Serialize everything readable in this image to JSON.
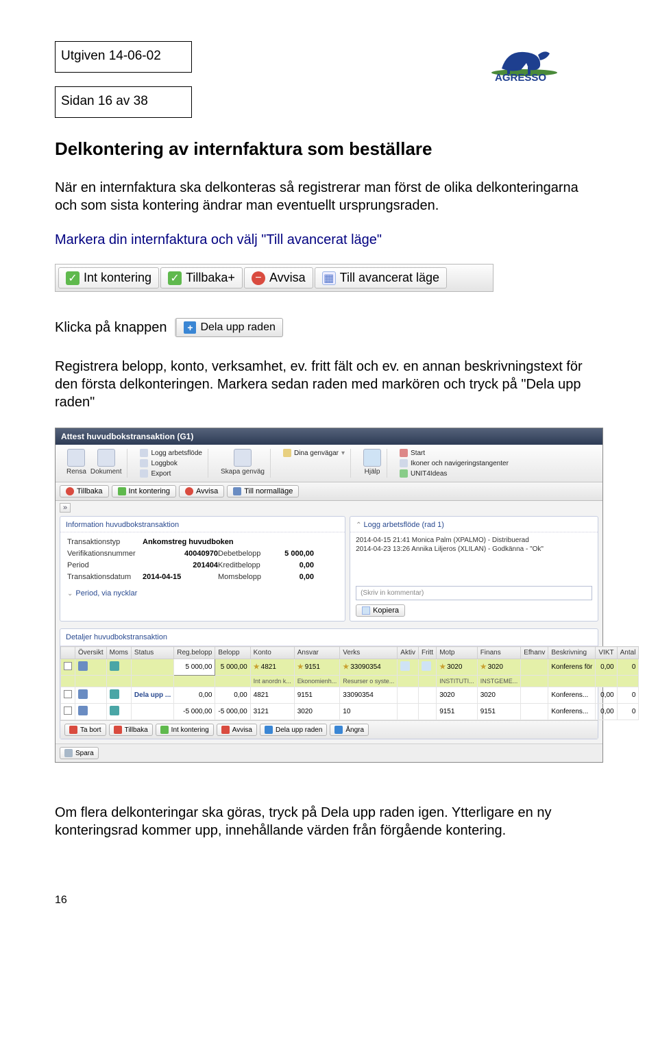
{
  "header": {
    "issued": "Utgiven 14-06-02",
    "page_info": "Sidan 16 av 38",
    "brand": "AGRESSO"
  },
  "title": "Delkontering av internfaktura som beställare",
  "para1": "När en internfaktura ska delkonteras så registrerar man först de olika delkonteringarna och som sista kontering ändrar man eventuellt ursprungsraden.",
  "marker_line": "Markera din internfaktura och välj \"Till avancerat läge\"",
  "toolbar1": {
    "int_kontering": "Int kontering",
    "tillbaka_plus": "Tillbaka+",
    "avvisa": "Avvisa",
    "till_avancerat": "Till avancerat läge"
  },
  "click_line": "Klicka på knappen",
  "split_btn": "Dela upp raden",
  "para2": "Registrera belopp, konto, verksamhet, ev. fritt fält och ev. en annan beskrivningstext för den första delkonteringen. Markera sedan raden med markören och tryck på \"Dela upp raden\"",
  "app": {
    "title": "Attest huvudbokstransaktion (G1)",
    "ribbon": {
      "rensa": "Rensa",
      "dokument": "Dokument",
      "logg_arbetsflode": "Logg arbetsflöde",
      "loggbok": "Loggbok",
      "export": "Export",
      "skapa_genvag": "Skapa genväg",
      "dina_genvagar": "Dina genvägar",
      "hjalp": "Hjälp",
      "start": "Start",
      "ikoner": "Ikoner och navigeringstangenter",
      "unit4": "UNIT4Ideas"
    },
    "toolbar2": {
      "tillbaka": "Tillbaka",
      "int_kontering": "Int kontering",
      "avvisa": "Avvisa",
      "normallage": "Till normalläge"
    },
    "info_pane": {
      "title": "Information huvudbokstransaktion",
      "labels": {
        "transaktionstyp": "Transaktionstyp",
        "verifikationsnummer": "Verifikationsnummer",
        "period": "Period",
        "transaktionsdatum": "Transaktionsdatum",
        "debetbelopp": "Debetbelopp",
        "kreditbelopp": "Kreditbelopp",
        "momsbelopp": "Momsbelopp"
      },
      "values": {
        "transaktionstyp": "Ankomstreg huvudboken",
        "verifikationsnummer": "40040970",
        "period": "201404",
        "transaktionsdatum": "2014-04-15",
        "debetbelopp": "5 000,00",
        "kreditbelopp": "0,00",
        "momsbelopp": "0,00"
      },
      "period_via": "Period, via nycklar"
    },
    "log_pane": {
      "title": "Logg arbetsflöde (rad 1)",
      "l1": "2014-04-15 21:41 Monica Palm (XPALMO) - Distribuerad",
      "l2": "2014-04-23 13:26 Annika Liljeros (XLILAN) - Godkänna - \"Ok\"",
      "comment_placeholder": "(Skriv in kommentar)",
      "kopiera": "Kopiera"
    },
    "detail": {
      "title": "Detaljer huvudbokstransaktion",
      "headers": [
        "",
        "Översikt",
        "Moms",
        "Status",
        "Reg.belopp",
        "Belopp",
        "Konto",
        "Ansvar",
        "Verks",
        "Aktiv",
        "Fritt",
        "Motp",
        "Finans",
        "Efhanv",
        "Beskrivning",
        "VIKT",
        "Antal"
      ],
      "row1": {
        "reg": "5 000,00",
        "belopp": "5 000,00",
        "konto": "4821",
        "ansvar": "9151",
        "verks": "33090354",
        "motp": "3020",
        "finans": "3020",
        "beskr": "Konferens för",
        "vikt": "0,00",
        "antal": "0"
      },
      "row1_sub": {
        "konto": "Int anordn k...",
        "ansvar": "Ekonomienh...",
        "verks": "Resurser o syste...",
        "motp": "INSTITUTI...",
        "finans": "INSTGEME..."
      },
      "row2": {
        "status": "Dela upp ...",
        "reg": "0,00",
        "belopp": "0,00",
        "konto": "4821",
        "ansvar": "9151",
        "verks": "33090354",
        "motp": "3020",
        "finans": "3020",
        "beskr": "Konferens...",
        "vikt": "0,00",
        "antal": "0"
      },
      "row3": {
        "reg": "-5 000,00",
        "belopp": "-5 000,00",
        "konto": "3121",
        "ansvar": "3020",
        "verks": "10",
        "motp": "9151",
        "finans": "9151",
        "beskr": "Konferens...",
        "vikt": "0,00",
        "antal": "0"
      }
    },
    "bottom_tb": {
      "ta_bort": "Ta bort",
      "tillbaka": "Tillbaka",
      "int_kontering": "Int kontering",
      "avvisa": "Avvisa",
      "dela_upp": "Dela upp raden",
      "angra": "Ångra"
    },
    "spara": "Spara"
  },
  "footer_para": "Om flera delkonteringar ska göras, tryck på Dela upp raden igen. Ytterligare en ny konteringsrad kommer upp, innehållande värden från förgående kontering.",
  "page_num": "16"
}
